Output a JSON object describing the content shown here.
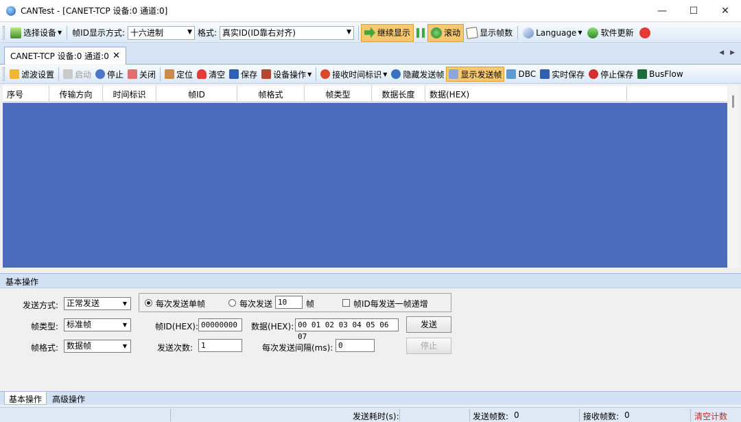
{
  "window": {
    "title": "CANTest  - [CANET-TCP 设备:0 通道:0]",
    "controls": {
      "minimize": "—",
      "maximize": "☐",
      "close": "✕"
    }
  },
  "toolbar1": {
    "select_device": "选择设备",
    "frame_id_mode_label": "帧ID显示方式:",
    "frame_id_mode_value": "十六进制",
    "format_label": "格式:",
    "format_value": "真实ID(ID靠右对齐)",
    "continue_display": "继续显示",
    "scroll": "滚动",
    "show_frame_count": "显示帧数",
    "language": "Language",
    "software_update": "软件更新"
  },
  "doc_tab": {
    "label": "CANET-TCP 设备:0 通道:0",
    "close": "✕",
    "nav": "◀ ▶"
  },
  "toolbar2": {
    "filter_settings": "滤波设置",
    "start": "启动",
    "stop": "停止",
    "close": "关闭",
    "locate": "定位",
    "clear": "清空",
    "save": "保存",
    "device_ops": "设备操作",
    "recv_time_mark": "接收时间标识",
    "hide_send_frames": "隐藏发送帧",
    "show_send_frames": "显示发送帧",
    "dbc": "DBC",
    "realtime_save": "实时保存",
    "stop_save": "停止保存",
    "busflow": "BusFlow"
  },
  "grid": {
    "columns": [
      "序号",
      "传输方向",
      "时间标识",
      "帧ID",
      "帧格式",
      "帧类型",
      "数据长度",
      "数据(HEX)"
    ]
  },
  "panel": {
    "title": "基本操作",
    "send_mode_label": "发送方式:",
    "send_mode_value": "正常发送",
    "radio_single": "每次发送单帧",
    "radio_multi": "每次发送",
    "multi_count": "10",
    "frame_unit": "帧",
    "id_increment": "帧ID每发送一帧递增",
    "frame_type_label": "帧类型:",
    "frame_type_value": "标准帧",
    "frame_id_label": "帧ID(HEX):",
    "frame_id_value": "00000000",
    "data_label": "数据(HEX):",
    "data_value": "00 01 02 03 04 05 06 07",
    "send_button": "发送",
    "frame_format_label": "帧格式:",
    "frame_format_value": "数据帧",
    "send_count_label": "发送次数:",
    "send_count_value": "1",
    "interval_label": "每次发送间隔(ms):",
    "interval_value": "0",
    "stop_button": "停止"
  },
  "bottom_tabs": {
    "basic": "基本操作",
    "advanced": "高级操作"
  },
  "status": {
    "send_time_label": "发送耗时(s):",
    "send_frames_label": "发送帧数:",
    "send_frames_value": "0",
    "recv_frames_label": "接收帧数:",
    "recv_frames_value": "0",
    "clear_count": "清空计数"
  }
}
